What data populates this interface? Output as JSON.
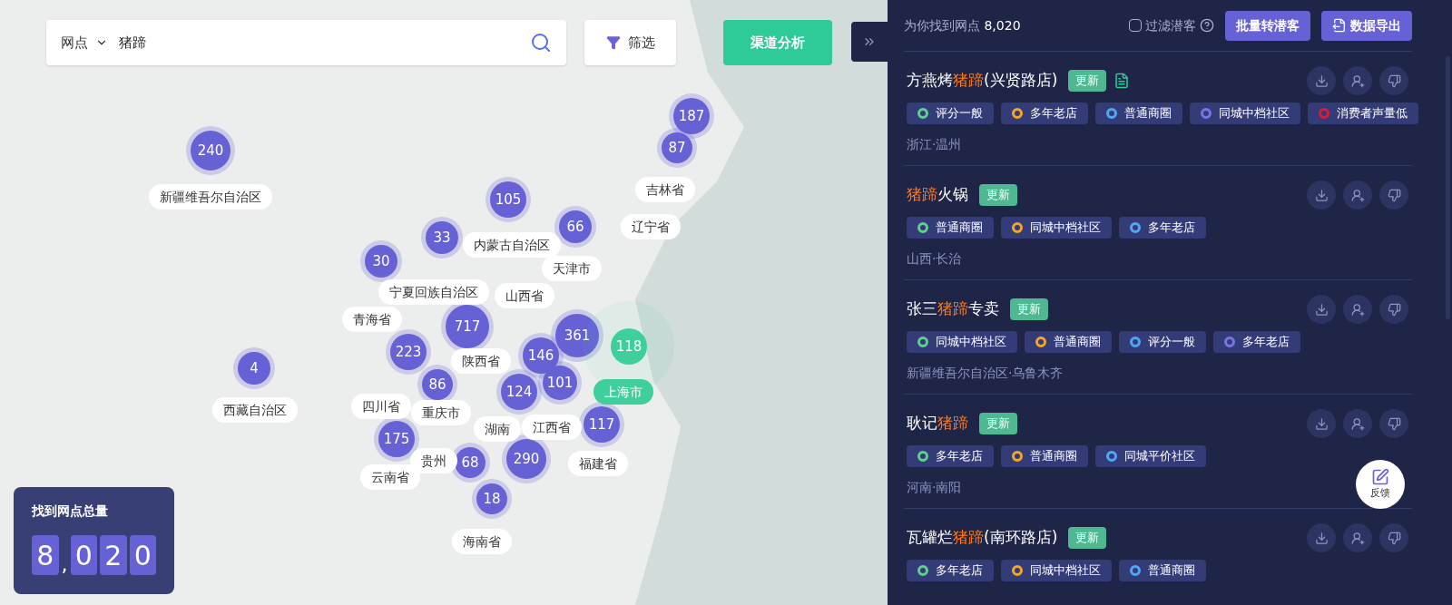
{
  "search": {
    "scope": "网点",
    "value": "猪蹄"
  },
  "filter_button": "筛选",
  "analysis_button": "渠道分析",
  "map": {
    "clusters": [
      {
        "count": "240",
        "selected": false
      },
      {
        "count": "187",
        "selected": false
      },
      {
        "count": "87",
        "selected": false
      },
      {
        "count": "105",
        "selected": false
      },
      {
        "count": "66",
        "selected": false
      },
      {
        "count": "33",
        "selected": false
      },
      {
        "count": "30",
        "selected": false
      },
      {
        "count": "717",
        "selected": false
      },
      {
        "count": "223",
        "selected": false
      },
      {
        "count": "86",
        "selected": false
      },
      {
        "count": "146",
        "selected": false
      },
      {
        "count": "361",
        "selected": false
      },
      {
        "count": "118",
        "selected": true
      },
      {
        "count": "124",
        "selected": false
      },
      {
        "count": "101",
        "selected": false
      },
      {
        "count": "117",
        "selected": false
      },
      {
        "count": "4",
        "selected": false
      },
      {
        "count": "175",
        "selected": false
      },
      {
        "count": "68",
        "selected": false
      },
      {
        "count": "290",
        "selected": false
      },
      {
        "count": "18",
        "selected": false
      }
    ],
    "labels": [
      {
        "text": "新疆维吾尔自治区",
        "selected": false
      },
      {
        "text": "吉林省",
        "selected": false
      },
      {
        "text": "辽宁省",
        "selected": false
      },
      {
        "text": "内蒙古自治区",
        "selected": false
      },
      {
        "text": "天津市",
        "selected": false
      },
      {
        "text": "宁夏回族自治区",
        "selected": false
      },
      {
        "text": "山西省",
        "selected": false
      },
      {
        "text": "青海省",
        "selected": false
      },
      {
        "text": "陕西省",
        "selected": false
      },
      {
        "text": "西藏自治区",
        "selected": false
      },
      {
        "text": "四川省",
        "selected": false
      },
      {
        "text": "重庆市",
        "selected": false
      },
      {
        "text": "湖南",
        "selected": false
      },
      {
        "text": "江西省",
        "selected": false
      },
      {
        "text": "福建省",
        "selected": false
      },
      {
        "text": "贵州",
        "selected": false
      },
      {
        "text": "云南省",
        "selected": false
      },
      {
        "text": "海南省",
        "selected": false
      },
      {
        "text": "上海市",
        "selected": true
      }
    ]
  },
  "total_card": {
    "title": "找到网点总量",
    "chars": [
      {
        "char": "8",
        "kind": "digit"
      },
      {
        "char": ",",
        "kind": "separator"
      },
      {
        "char": "0",
        "kind": "digit"
      },
      {
        "char": "2",
        "kind": "digit"
      },
      {
        "char": "0",
        "kind": "digit"
      }
    ]
  },
  "results": {
    "summary_label": "为你找到网点",
    "summary_count": "8,020",
    "filter_checkbox": {
      "label": "过滤潜客",
      "checked": false
    },
    "buttons": [
      {
        "label": "批量转潜客",
        "kind": "plain"
      },
      {
        "label": "数据导出",
        "kind": "export"
      }
    ],
    "items": [
      {
        "title": [
          {
            "text": "方燕烤",
            "highlight": false
          },
          {
            "text": "猪蹄",
            "highlight": true
          },
          {
            "text": "(兴贤路店)",
            "highlight": false
          }
        ],
        "badge": "更新",
        "attachment": true,
        "tags": [
          {
            "label": "评分一般",
            "color": "#5fd08f"
          },
          {
            "label": "多年老店",
            "color": "#f5a623"
          },
          {
            "label": "普通商圈",
            "color": "#4fa8f5"
          },
          {
            "label": "同城中档社区",
            "color": "#7b73e6"
          },
          {
            "label": "消费者声量低",
            "color": "#e0193b"
          }
        ],
        "location": "浙江·温州"
      },
      {
        "title": [
          {
            "text": "猪蹄",
            "highlight": true
          },
          {
            "text": "火锅",
            "highlight": false
          }
        ],
        "badge": "更新",
        "attachment": false,
        "tags": [
          {
            "label": "普通商圈",
            "color": "#5fd08f"
          },
          {
            "label": "同城中档社区",
            "color": "#f5a623"
          },
          {
            "label": "多年老店",
            "color": "#4fa8f5"
          }
        ],
        "location": "山西·长治"
      },
      {
        "title": [
          {
            "text": "张三",
            "highlight": false
          },
          {
            "text": "猪蹄",
            "highlight": true
          },
          {
            "text": "专卖",
            "highlight": false
          }
        ],
        "badge": "更新",
        "attachment": false,
        "tags": [
          {
            "label": "同城中档社区",
            "color": "#5fd08f"
          },
          {
            "label": "普通商圈",
            "color": "#f5a623"
          },
          {
            "label": "评分一般",
            "color": "#4fa8f5"
          },
          {
            "label": "多年老店",
            "color": "#7b73e6"
          }
        ],
        "location": "新疆维吾尔自治区·乌鲁木齐"
      },
      {
        "title": [
          {
            "text": "耿记",
            "highlight": false
          },
          {
            "text": "猪蹄",
            "highlight": true
          }
        ],
        "badge": "更新",
        "attachment": false,
        "tags": [
          {
            "label": "多年老店",
            "color": "#5fd08f"
          },
          {
            "label": "普通商圈",
            "color": "#f5a623"
          },
          {
            "label": "同城平价社区",
            "color": "#4fa8f5"
          }
        ],
        "location": "河南·南阳"
      },
      {
        "title": [
          {
            "text": "瓦罐烂",
            "highlight": false
          },
          {
            "text": "猪蹄",
            "highlight": true
          },
          {
            "text": "(南环路店)",
            "highlight": false
          }
        ],
        "badge": "更新",
        "attachment": false,
        "tags": [
          {
            "label": "多年老店",
            "color": "#5fd08f"
          },
          {
            "label": "同城中档社区",
            "color": "#f5a623"
          },
          {
            "label": "普通商圈",
            "color": "#4fa8f5"
          }
        ]
      }
    ]
  },
  "feedback_button": "反馈"
}
